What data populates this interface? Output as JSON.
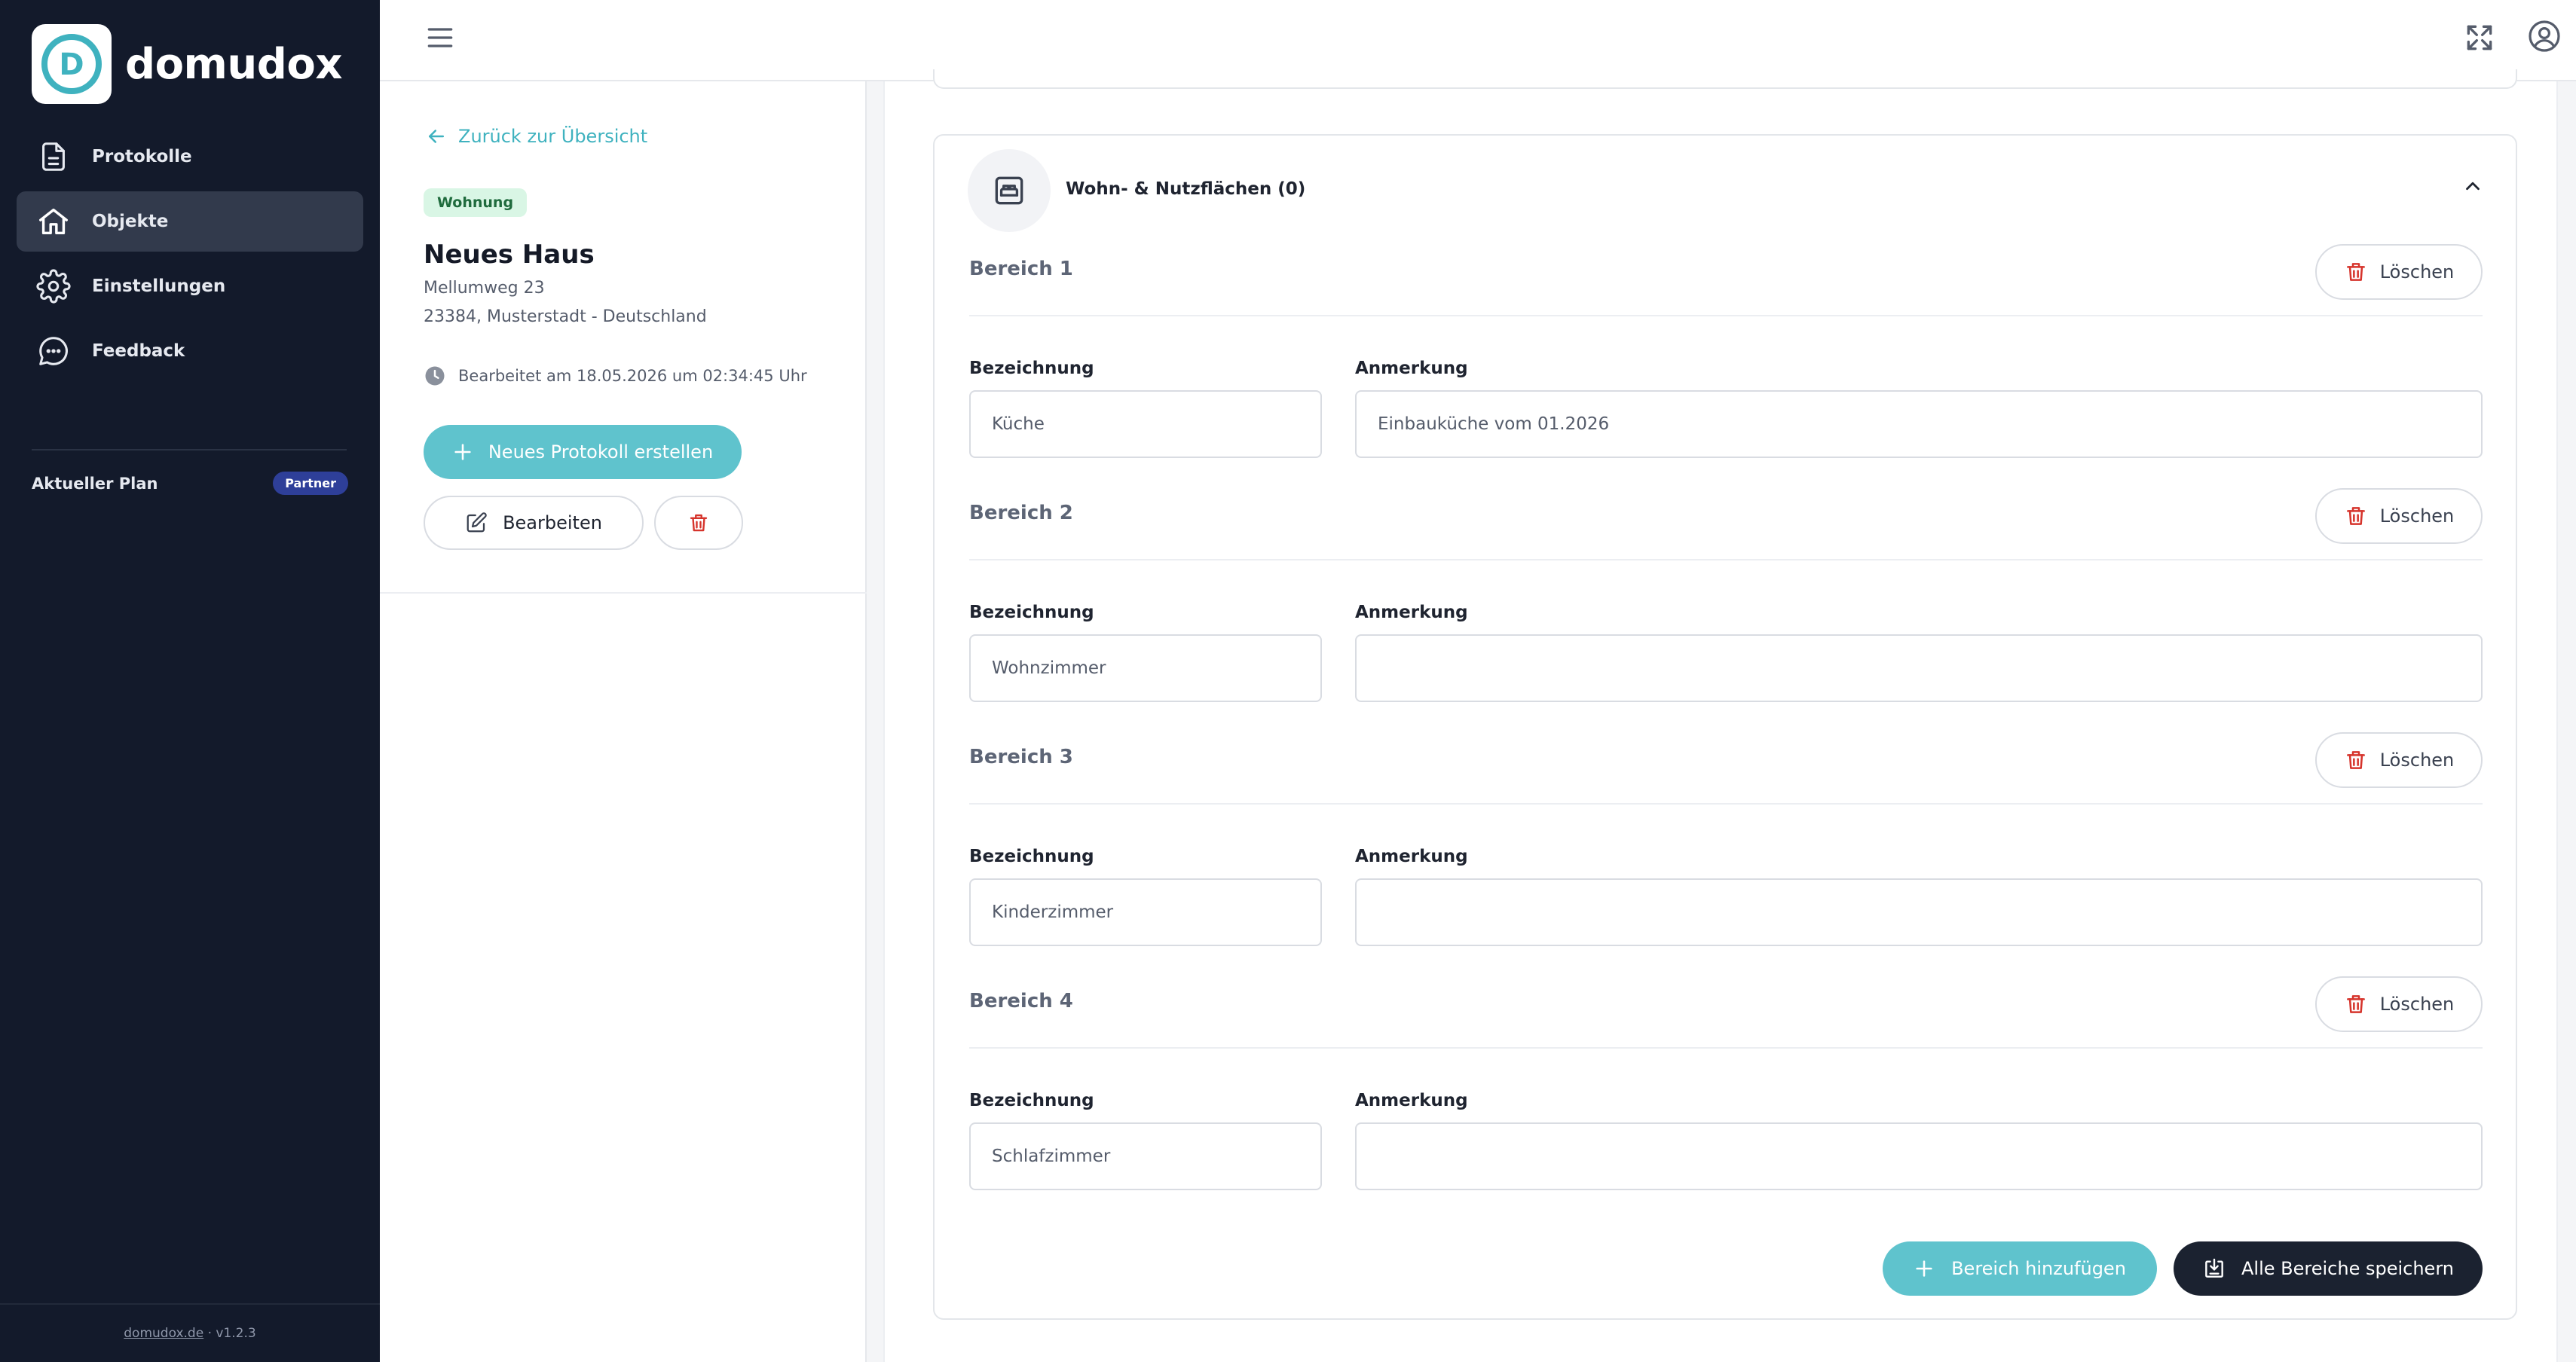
{
  "brand": {
    "name": "domudox",
    "logo_letter": "D",
    "accent_color": "#5fc3cd"
  },
  "sidebar": {
    "items": [
      {
        "label": "Protokolle",
        "icon": "document-icon",
        "active": false
      },
      {
        "label": "Objekte",
        "icon": "home-icon",
        "active": true
      },
      {
        "label": "Einstellungen",
        "icon": "gear-icon",
        "active": false
      },
      {
        "label": "Feedback",
        "icon": "chat-bubble-icon",
        "active": false
      }
    ],
    "plan_label": "Aktueller Plan",
    "plan_badge": "Partner",
    "footer_link": "domudox.de",
    "footer_separator": "·",
    "version": "v1.2.3"
  },
  "topbar": {
    "menu_icon": "hamburger-icon",
    "fullscreen_icon": "expand-icon",
    "account_icon": "user-circle-icon"
  },
  "detail": {
    "back_label": "Zurück zur Übersicht",
    "type_badge": "Wohnung",
    "title": "Neues Haus",
    "street": "Mellumweg 23",
    "city_line": "23384, Musterstadt - Deutschland",
    "edited_text": "Bearbeitet am 18.05.2026 um 02:34:45 Uhr",
    "new_protocol_label": "Neues Protokoll erstellen",
    "edit_label": "Bearbeiten"
  },
  "section": {
    "title": "Wohn- & Nutzflächen (0)",
    "icon": "bed-icon",
    "delete_label": "Löschen",
    "name_label": "Bezeichnung",
    "note_label": "Anmerkung",
    "areas": [
      {
        "title": "Bereich 1",
        "name": "Küche",
        "note": "Einbauküche vom 01.2026"
      },
      {
        "title": "Bereich 2",
        "name": "Wohnzimmer",
        "note": ""
      },
      {
        "title": "Bereich 3",
        "name": "Kinderzimmer",
        "note": ""
      },
      {
        "title": "Bereich 4",
        "name": "Schlafzimmer",
        "note": ""
      }
    ],
    "add_label": "Bereich hinzufügen",
    "save_all_label": "Alle Bereiche speichern"
  }
}
